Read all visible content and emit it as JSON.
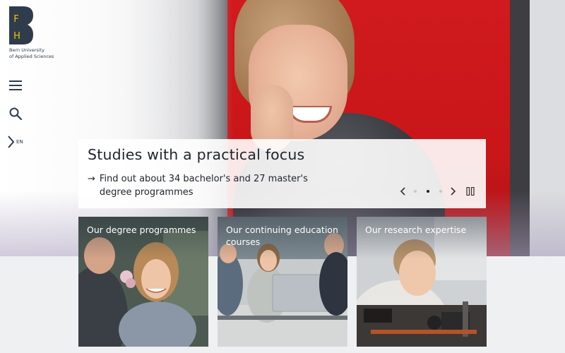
{
  "brand": {
    "logo_letters": [
      "F",
      "H"
    ],
    "name_line1": "Bern University",
    "name_line2": "of Applied Sciences",
    "logo_color": "#2f3c4c",
    "logo_letter_color": "#f5c400"
  },
  "nav": {
    "menu_icon": "hamburger-icon",
    "search_icon": "search-icon",
    "language_code": "EN"
  },
  "hero": {
    "title": "Studies with a practical focus",
    "link_arrow": "→",
    "link_text": "Find out about 34 bachelor's and 27 master's degree programmes",
    "slider": {
      "total_slides": 3,
      "active_slide": 2
    }
  },
  "tiles": [
    {
      "title": "Our degree programmes"
    },
    {
      "title": "Our continuing education courses"
    },
    {
      "title": "Our research expertise"
    }
  ]
}
